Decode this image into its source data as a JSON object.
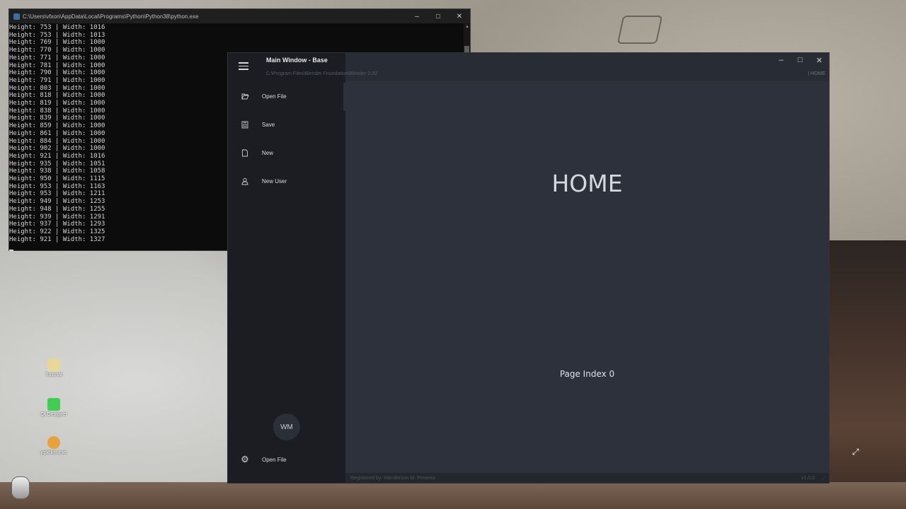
{
  "console": {
    "title": "C:\\Users\\vfxon\\AppData\\Local\\Programs\\Python\\Python38\\python.exe",
    "lines": [
      "Height: 753 | Width: 1016",
      "Height: 753 | Width: 1013",
      "Height: 769 | Width: 1000",
      "Height: 770 | Width: 1000",
      "Height: 771 | Width: 1000",
      "Height: 781 | Width: 1000",
      "Height: 790 | Width: 1000",
      "Height: 791 | Width: 1000",
      "Height: 803 | Width: 1000",
      "Height: 818 | Width: 1000",
      "Height: 819 | Width: 1000",
      "Height: 838 | Width: 1000",
      "Height: 839 | Width: 1000",
      "Height: 859 | Width: 1000",
      "Height: 861 | Width: 1000",
      "Height: 884 | Width: 1000",
      "Height: 902 | Width: 1000",
      "Height: 921 | Width: 1016",
      "Height: 935 | Width: 1051",
      "Height: 938 | Width: 1058",
      "Height: 950 | Width: 1115",
      "Height: 953 | Width: 1163",
      "Height: 953 | Width: 1211",
      "Height: 949 | Width: 1253",
      "Height: 948 | Width: 1255",
      "Height: 939 | Width: 1291",
      "Height: 937 | Width: 1293",
      "Height: 922 | Width: 1325",
      "Height: 921 | Width: 1327"
    ]
  },
  "app": {
    "title": "Main Window - Base",
    "path": "C:\\Program Files\\Blender Foundation\\Blender 2.82",
    "current_page": "| HOME",
    "sidebar": {
      "items": [
        {
          "label": "Open File",
          "icon": "folder-open-icon"
        },
        {
          "label": "Save",
          "icon": "save-icon"
        },
        {
          "label": "New",
          "icon": "file-icon"
        },
        {
          "label": "New User",
          "icon": "user-add-icon"
        }
      ],
      "avatar": "WM",
      "bottom_item": {
        "label": "Open File",
        "icon": "settings-icon"
      }
    },
    "content": {
      "heading": "HOME",
      "page_index": "Page Index 0"
    },
    "status": {
      "registered": "Registered by: Wanderson M. Pimenta",
      "version": "v1.0.0"
    }
  },
  "desktop": {
    "icons": [
      {
        "label": "Tutorial",
        "color": "#e9d79a"
      },
      {
        "label": "Qt Designer",
        "color": "#41cd52"
      },
      {
        "label": "jcpicker.exe",
        "color": "#e9a23b"
      }
    ]
  }
}
